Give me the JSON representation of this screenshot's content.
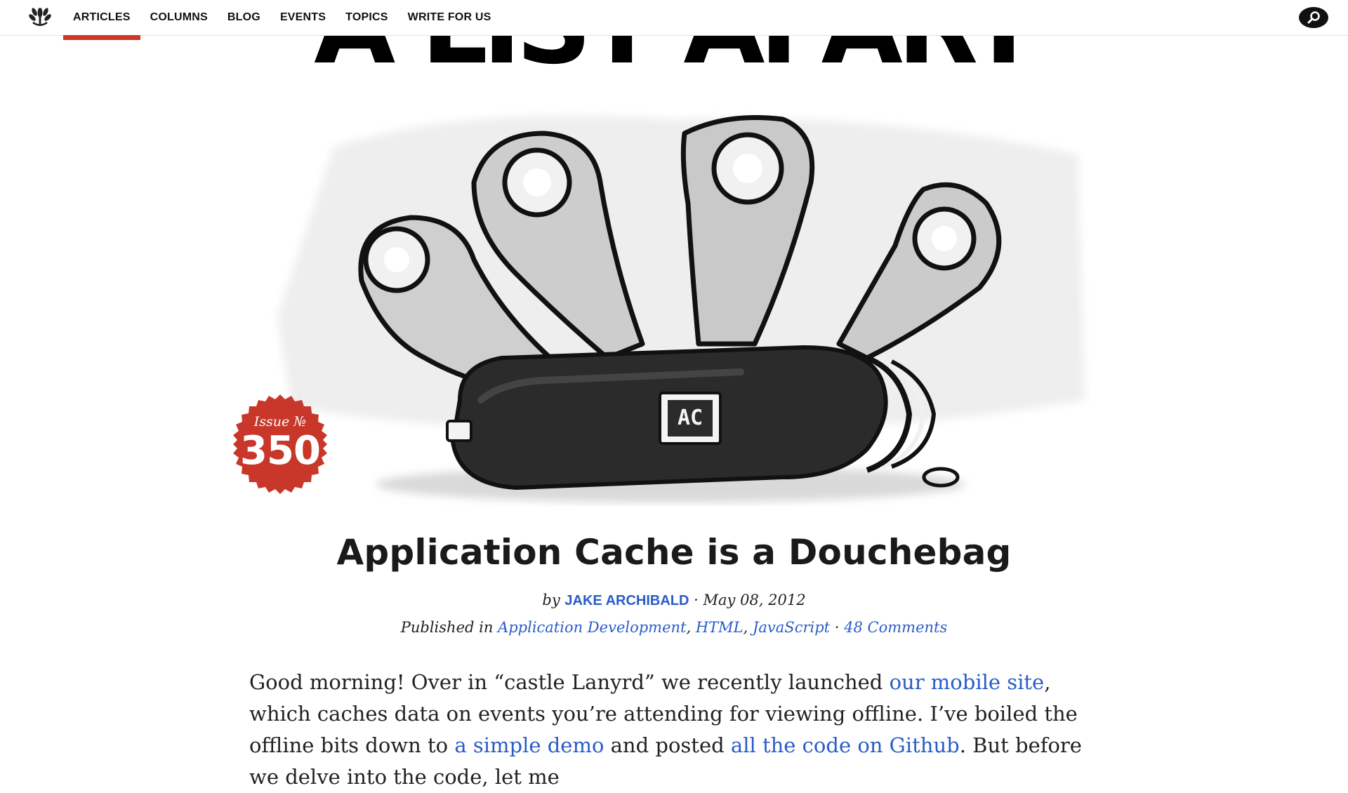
{
  "masthead": {
    "title": "A LIST APART"
  },
  "nav": {
    "items": [
      {
        "label": "ARTICLES",
        "active": true
      },
      {
        "label": "COLUMNS"
      },
      {
        "label": "BLOG"
      },
      {
        "label": "EVENTS"
      },
      {
        "label": "TOPICS"
      },
      {
        "label": "WRITE FOR US"
      }
    ],
    "logo_icon": "laurel-logo-icon",
    "search_icon": "search-icon"
  },
  "hero": {
    "illustration": "swiss-army-knife-illustration",
    "knife_badge": "AC",
    "issue_label": "Issue №",
    "issue_number": "350",
    "badge_color": "#c8372a"
  },
  "article": {
    "title": "Application Cache is a Douchebag",
    "by": "by",
    "author": "JAKE ARCHIBALD",
    "separator": "·",
    "date": "May 08, 2012",
    "published_in": "Published in",
    "topics": [
      "Application Development",
      "HTML",
      "JavaScript"
    ],
    "comments": "48 Comments",
    "intro": {
      "t1": "Good morning! Over in “castle Lanyrd” we recently launched ",
      "l1": "our mobile site",
      "t2": ", which caches data on events you’re attending for viewing offline. I’ve boiled the offline bits down to ",
      "l2": "a simple demo",
      "t3": " and posted ",
      "l3": "all the code on Github",
      "t4": ". But before we delve into the code, let me"
    }
  },
  "colors": {
    "link": "#2a5cc7",
    "accent": "#d0362a"
  }
}
